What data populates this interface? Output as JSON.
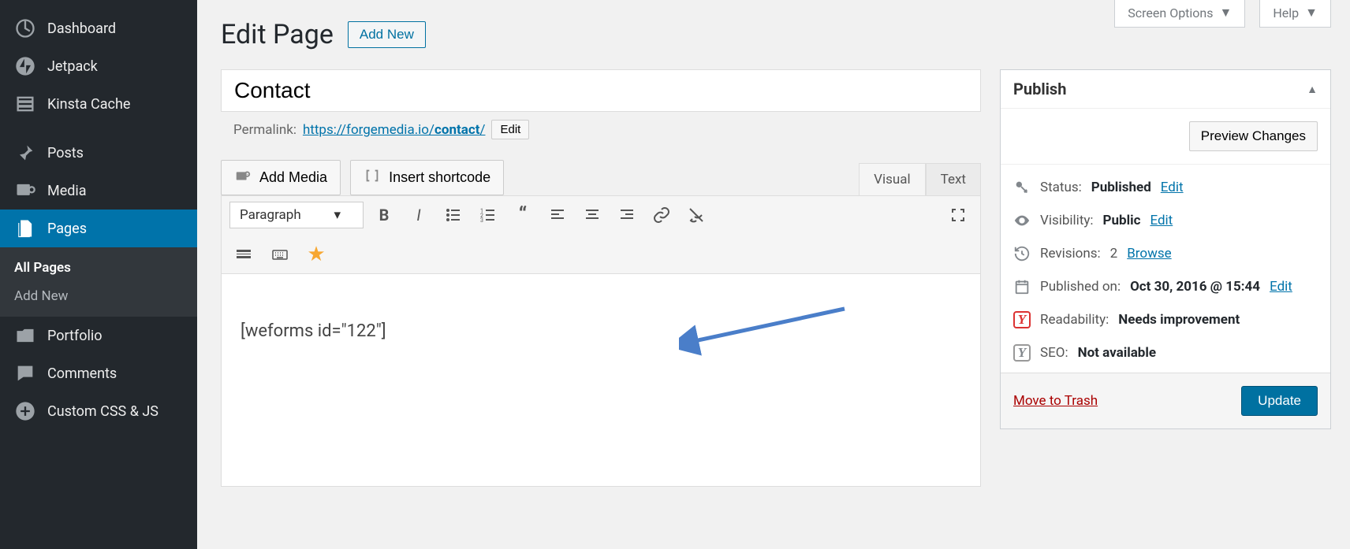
{
  "top": {
    "screen_options": "Screen Options",
    "help": "Help"
  },
  "heading": {
    "title": "Edit Page",
    "add_new": "Add New"
  },
  "sidebar": {
    "items": [
      {
        "label": "Dashboard"
      },
      {
        "label": "Jetpack"
      },
      {
        "label": "Kinsta Cache"
      },
      {
        "label": "Posts"
      },
      {
        "label": "Media"
      },
      {
        "label": "Pages"
      },
      {
        "label": "Portfolio"
      },
      {
        "label": "Comments"
      },
      {
        "label": "Custom CSS & JS"
      }
    ],
    "sub": {
      "all_pages": "All Pages",
      "add_new": "Add New"
    }
  },
  "editor": {
    "title_value": "Contact",
    "permalink_label": "Permalink:",
    "permalink_base": "https://forgemedia.io/",
    "permalink_slug": "contact",
    "permalink_trail": "/",
    "edit_btn": "Edit",
    "add_media": "Add Media",
    "insert_shortcode": "Insert shortcode",
    "tab_visual": "Visual",
    "tab_text": "Text",
    "format": "Paragraph",
    "content": "[weforms id=\"122\"]"
  },
  "publish": {
    "heading": "Publish",
    "preview": "Preview Changes",
    "status_label": "Status:",
    "status_value": "Published",
    "status_edit": "Edit",
    "visibility_label": "Visibility:",
    "visibility_value": "Public",
    "visibility_edit": "Edit",
    "revisions_label": "Revisions:",
    "revisions_value": "2",
    "revisions_browse": "Browse",
    "published_label": "Published on:",
    "published_value": "Oct 30, 2016 @ 15:44",
    "published_edit": "Edit",
    "readability_label": "Readability:",
    "readability_value": "Needs improvement",
    "seo_label": "SEO:",
    "seo_value": "Not available",
    "trash": "Move to Trash",
    "update": "Update"
  }
}
